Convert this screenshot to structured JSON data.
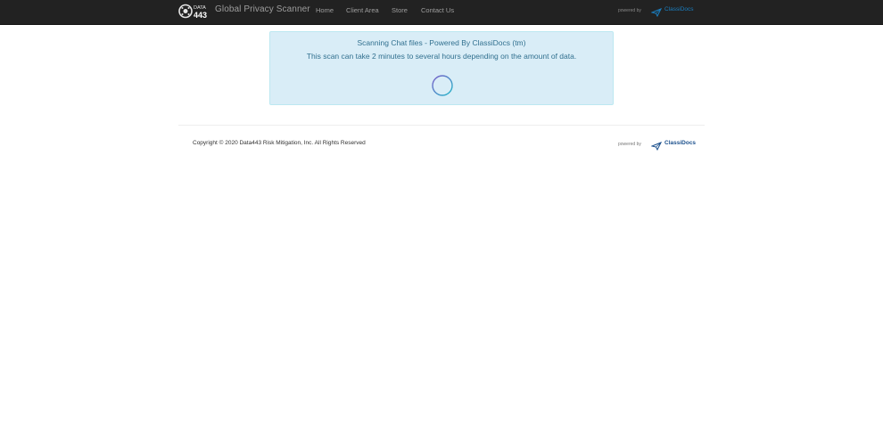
{
  "navbar": {
    "logo_text_top": "DATA",
    "logo_text_bottom": "443",
    "title": "Global Privacy Scanner",
    "links": [
      {
        "label": "Home"
      },
      {
        "label": "Client Area"
      },
      {
        "label": "Store"
      },
      {
        "label": "Contact Us"
      }
    ],
    "powered_by": "powered by",
    "classidocs_label": "ClassiDocs",
    "classidocs_color": "#1a7fc1"
  },
  "alert": {
    "title": "Scanning Chat files - Powered By ClassiDocs (tm)",
    "message": "This scan can take 2 minutes to several hours depending on the amount of data.",
    "background": "#d9edf7",
    "text_color": "#31708f",
    "spinner_icon": "loading-spinner-icon"
  },
  "footer": {
    "copyright": "Copyright © 2020 Data443 Risk Mitigation, Inc. All Rights Reserved",
    "powered_by": "powered by",
    "classidocs_label": "ClassiDocs",
    "classidocs_color": "#1a4f8c"
  }
}
